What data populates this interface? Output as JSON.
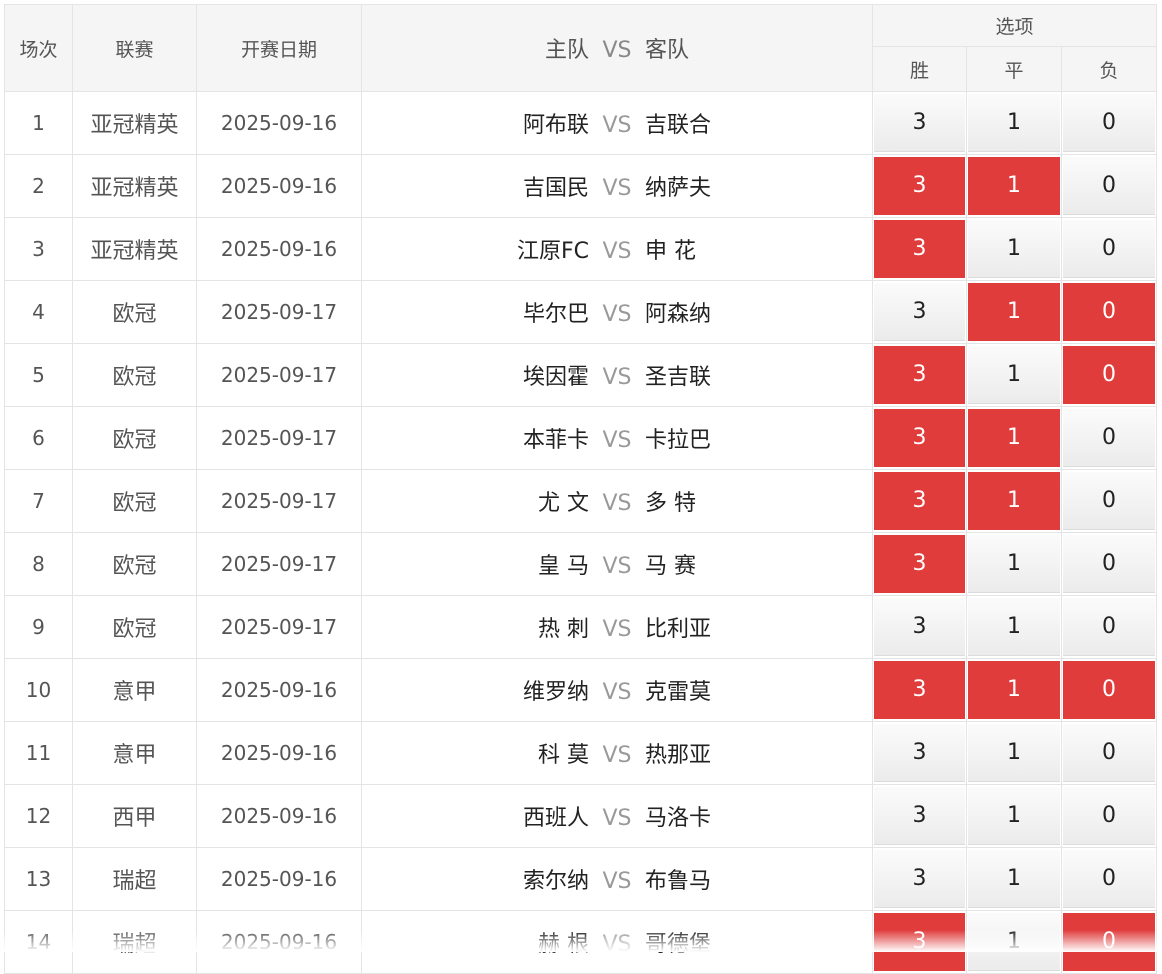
{
  "header": {
    "col_index": "场次",
    "col_league": "联赛",
    "col_date": "开赛日期",
    "col_home": "主队",
    "col_vs": "VS",
    "col_away": "客队",
    "col_options": "选项",
    "opt_win": "胜",
    "opt_draw": "平",
    "opt_lose": "负"
  },
  "colors": {
    "selected": "#e03c3c",
    "unselected": "#f2f2f2"
  },
  "rows": [
    {
      "no": "1",
      "league": "亚冠精英",
      "date": "2025-09-16",
      "home": "阿布联",
      "vs": "VS",
      "away": "吉联合",
      "win": "3",
      "draw": "1",
      "lose": "0",
      "sel": [
        false,
        false,
        false
      ]
    },
    {
      "no": "2",
      "league": "亚冠精英",
      "date": "2025-09-16",
      "home": "吉国民",
      "vs": "VS",
      "away": "纳萨夫",
      "win": "3",
      "draw": "1",
      "lose": "0",
      "sel": [
        true,
        true,
        false
      ]
    },
    {
      "no": "3",
      "league": "亚冠精英",
      "date": "2025-09-16",
      "home": "江原FC",
      "vs": "VS",
      "away": "申 花",
      "win": "3",
      "draw": "1",
      "lose": "0",
      "sel": [
        true,
        false,
        false
      ]
    },
    {
      "no": "4",
      "league": "欧冠",
      "date": "2025-09-17",
      "home": "毕尔巴",
      "vs": "VS",
      "away": "阿森纳",
      "win": "3",
      "draw": "1",
      "lose": "0",
      "sel": [
        false,
        true,
        true
      ]
    },
    {
      "no": "5",
      "league": "欧冠",
      "date": "2025-09-17",
      "home": "埃因霍",
      "vs": "VS",
      "away": "圣吉联",
      "win": "3",
      "draw": "1",
      "lose": "0",
      "sel": [
        true,
        false,
        true
      ]
    },
    {
      "no": "6",
      "league": "欧冠",
      "date": "2025-09-17",
      "home": "本菲卡",
      "vs": "VS",
      "away": "卡拉巴",
      "win": "3",
      "draw": "1",
      "lose": "0",
      "sel": [
        true,
        true,
        false
      ]
    },
    {
      "no": "7",
      "league": "欧冠",
      "date": "2025-09-17",
      "home": "尤 文",
      "vs": "VS",
      "away": "多 特",
      "win": "3",
      "draw": "1",
      "lose": "0",
      "sel": [
        true,
        true,
        false
      ]
    },
    {
      "no": "8",
      "league": "欧冠",
      "date": "2025-09-17",
      "home": "皇 马",
      "vs": "VS",
      "away": "马 赛",
      "win": "3",
      "draw": "1",
      "lose": "0",
      "sel": [
        true,
        false,
        false
      ]
    },
    {
      "no": "9",
      "league": "欧冠",
      "date": "2025-09-17",
      "home": "热 刺",
      "vs": "VS",
      "away": "比利亚",
      "win": "3",
      "draw": "1",
      "lose": "0",
      "sel": [
        false,
        false,
        false
      ]
    },
    {
      "no": "10",
      "league": "意甲",
      "date": "2025-09-16",
      "home": "维罗纳",
      "vs": "VS",
      "away": "克雷莫",
      "win": "3",
      "draw": "1",
      "lose": "0",
      "sel": [
        true,
        true,
        true
      ]
    },
    {
      "no": "11",
      "league": "意甲",
      "date": "2025-09-16",
      "home": "科 莫",
      "vs": "VS",
      "away": "热那亚",
      "win": "3",
      "draw": "1",
      "lose": "0",
      "sel": [
        false,
        false,
        false
      ]
    },
    {
      "no": "12",
      "league": "西甲",
      "date": "2025-09-16",
      "home": "西班人",
      "vs": "VS",
      "away": "马洛卡",
      "win": "3",
      "draw": "1",
      "lose": "0",
      "sel": [
        false,
        false,
        false
      ]
    },
    {
      "no": "13",
      "league": "瑞超",
      "date": "2025-09-16",
      "home": "索尔纳",
      "vs": "VS",
      "away": "布鲁马",
      "win": "3",
      "draw": "1",
      "lose": "0",
      "sel": [
        false,
        false,
        false
      ]
    },
    {
      "no": "14",
      "league": "瑞超",
      "date": "2025-09-16",
      "home": "赫 根",
      "vs": "VS",
      "away": "哥德堡",
      "win": "3",
      "draw": "1",
      "lose": "0",
      "sel": [
        true,
        false,
        true
      ]
    }
  ]
}
